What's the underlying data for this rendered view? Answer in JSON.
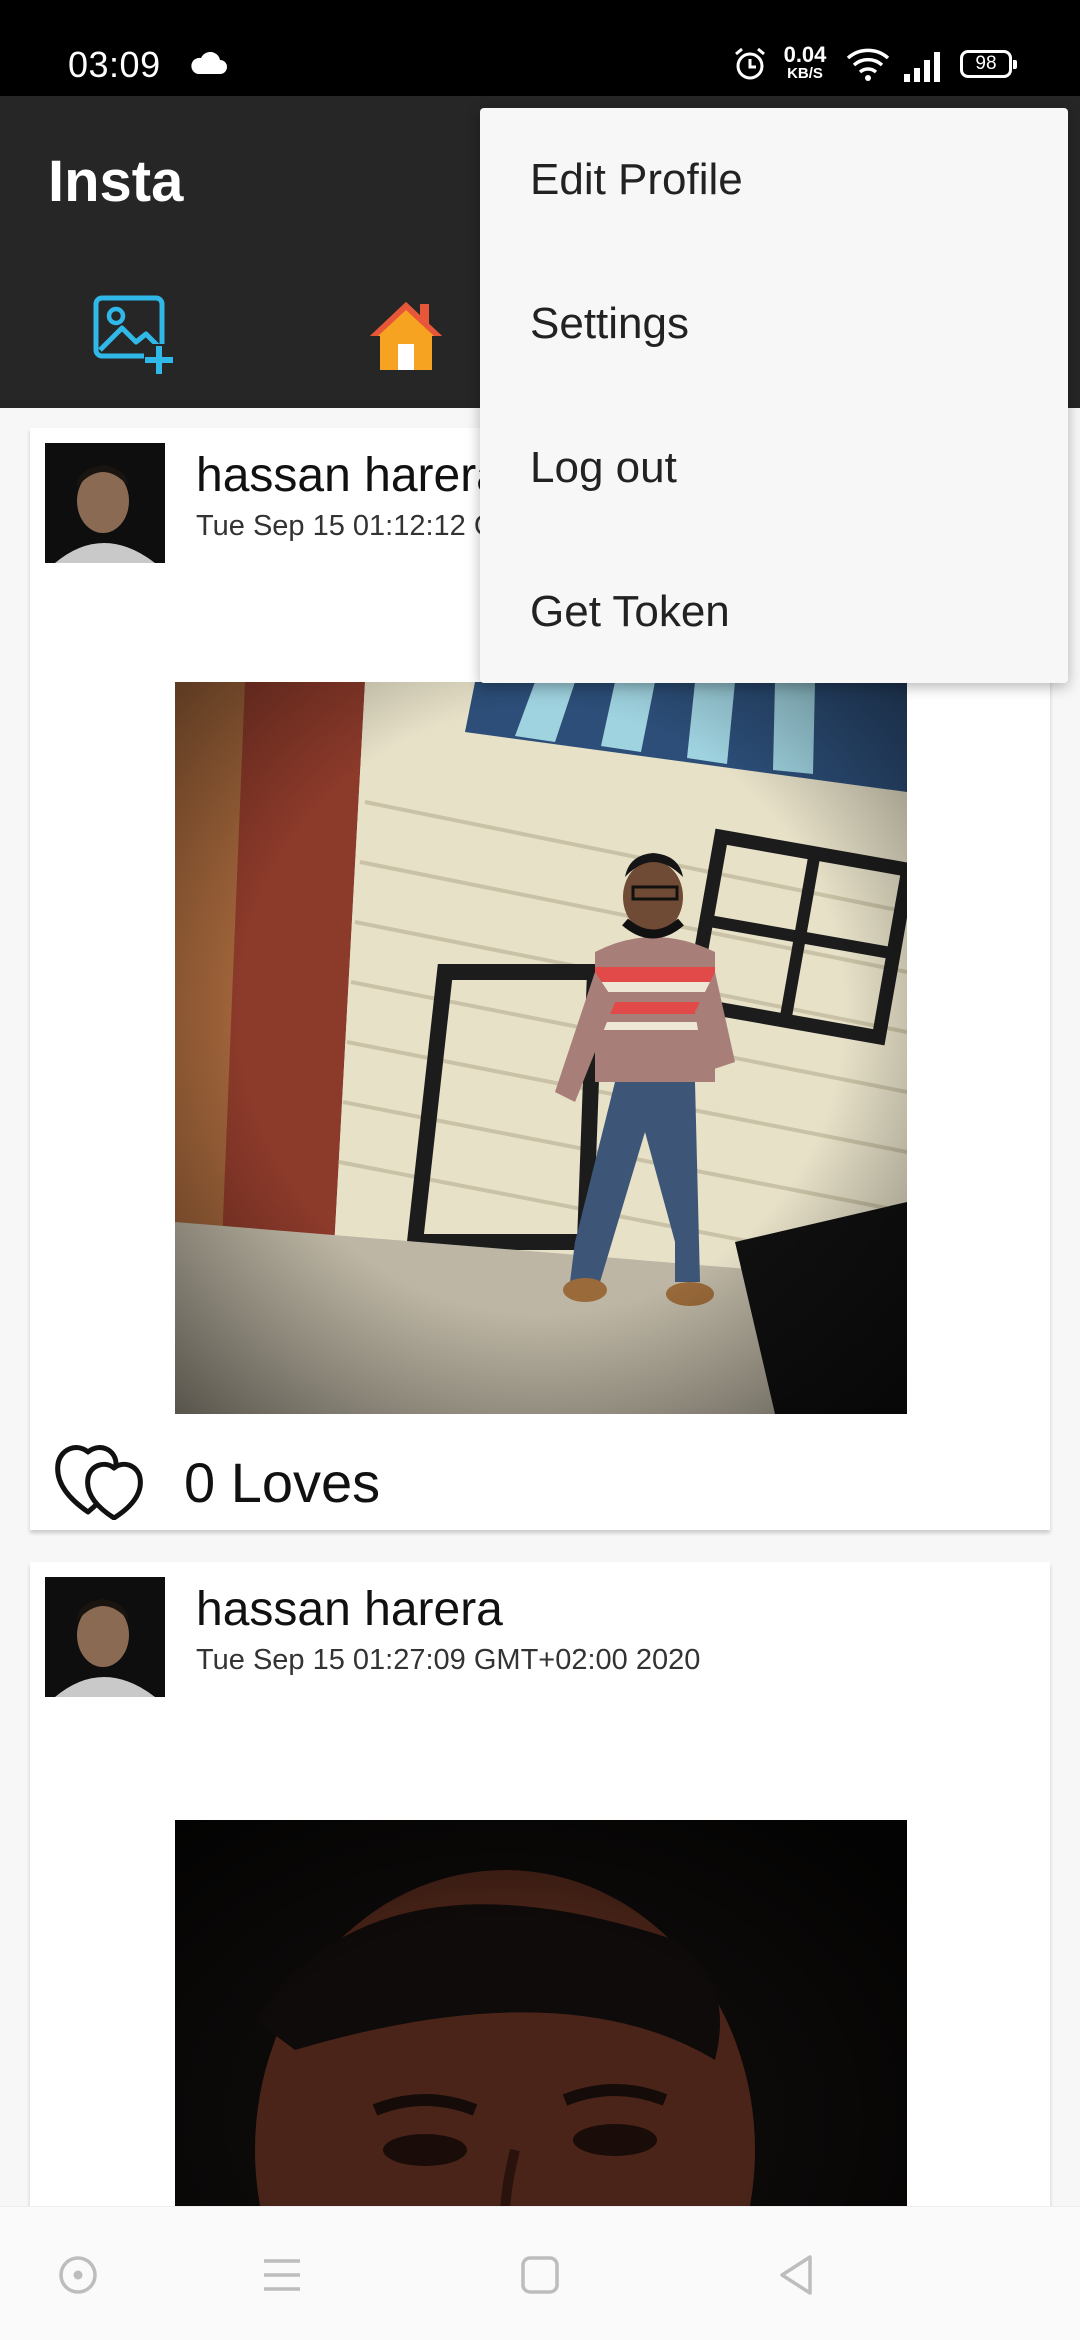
{
  "status_bar": {
    "time": "03:09",
    "net_speed_value": "0.04",
    "net_speed_unit": "KB/S",
    "battery": "98",
    "icons": [
      "cloud-icon",
      "alarm-icon",
      "wifi-icon",
      "signal-icon",
      "battery-icon"
    ]
  },
  "app_bar": {
    "title": "Insta",
    "tabs": [
      {
        "icon": "add-photo-icon",
        "color": "#2fb8e8"
      },
      {
        "icon": "home-icon",
        "color": "#f5a321"
      }
    ]
  },
  "menu": {
    "items": [
      "Edit Profile",
      "Settings",
      "Log out",
      "Get Token"
    ]
  },
  "posts": [
    {
      "username": "hassan harera",
      "date": "Tue Sep 15 01:12:12 GMT+02:00 2020",
      "loves": "0 Loves"
    },
    {
      "username": "hassan harera",
      "date": "Tue Sep 15 01:27:09 GMT+02:00 2020"
    }
  ],
  "nav_bar": {
    "icons": [
      "assistant-icon",
      "recents-icon",
      "home-button-icon",
      "back-icon"
    ]
  },
  "colors": {
    "app_bar": "#262626",
    "accent_blue": "#2fb8e8",
    "accent_orange": "#f5a321"
  }
}
